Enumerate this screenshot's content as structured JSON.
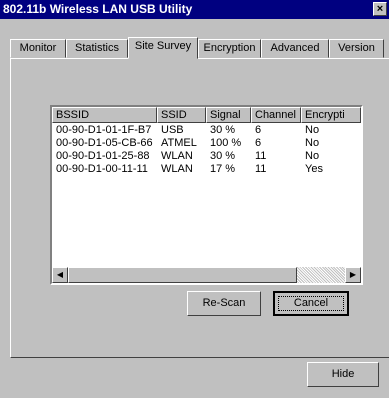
{
  "window": {
    "title": "802.11b Wireless LAN USB Utility",
    "close_glyph": "×"
  },
  "tabs": [
    {
      "label": "Monitor"
    },
    {
      "label": "Statistics"
    },
    {
      "label": "Site Survey",
      "active": true
    },
    {
      "label": "Encryption"
    },
    {
      "label": "Advanced"
    },
    {
      "label": "Version"
    }
  ],
  "survey": {
    "columns": [
      "BSSID",
      "SSID",
      "Signal",
      "Channel",
      "Encrypti"
    ],
    "rows": [
      {
        "bssid": "00-90-D1-01-1F-B7",
        "ssid": "USB",
        "signal": "30 %",
        "channel": "6",
        "encryption": "No"
      },
      {
        "bssid": "00-90-D1-05-CB-66",
        "ssid": "ATMEL",
        "signal": "100 %",
        "channel": "6",
        "encryption": "No"
      },
      {
        "bssid": "00-90-D1-01-25-88",
        "ssid": "WLAN",
        "signal": "30 %",
        "channel": "11",
        "encryption": "No"
      },
      {
        "bssid": "00-90-D1-00-11-11",
        "ssid": "WLAN",
        "signal": "17 %",
        "channel": "11",
        "encryption": "Yes"
      }
    ],
    "scroll_left_glyph": "◀",
    "scroll_right_glyph": "▶"
  },
  "buttons": {
    "rescan": "Re-Scan",
    "cancel": "Cancel",
    "hide": "Hide"
  }
}
